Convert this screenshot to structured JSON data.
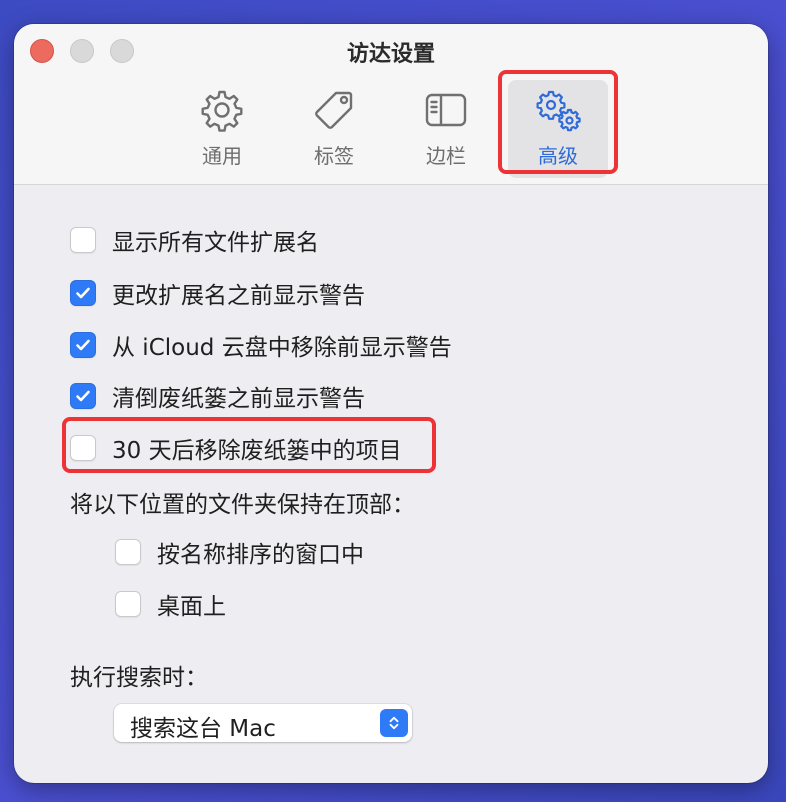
{
  "window": {
    "title": "访达设置"
  },
  "tabs": [
    {
      "id": "general",
      "label": "通用",
      "icon": "gear-icon",
      "active": false
    },
    {
      "id": "tags",
      "label": "标签",
      "icon": "tag-icon",
      "active": false
    },
    {
      "id": "sidebar",
      "label": "边栏",
      "icon": "sidebar-icon",
      "active": false
    },
    {
      "id": "advanced",
      "label": "高级",
      "icon": "gears-icon",
      "active": true
    }
  ],
  "options": [
    {
      "label": "显示所有文件扩展名",
      "checked": false
    },
    {
      "label": "更改扩展名之前显示警告",
      "checked": true
    },
    {
      "label": "从 iCloud 云盘中移除前显示警告",
      "checked": true
    },
    {
      "label": "清倒废纸篓之前显示警告",
      "checked": true
    },
    {
      "label": "30 天后移除废纸篓中的项目",
      "checked": false
    }
  ],
  "keep_folders": {
    "label": "将以下位置的文件夹保持在顶部：",
    "options": [
      {
        "label": "按名称排序的窗口中",
        "checked": false
      },
      {
        "label": "桌面上",
        "checked": false
      }
    ]
  },
  "search": {
    "label": "执行搜索时：",
    "selected": "搜索这台 Mac"
  },
  "colors": {
    "accent": "#2f7af6",
    "highlight": "#ee3336",
    "close": "#ed6a5e"
  }
}
